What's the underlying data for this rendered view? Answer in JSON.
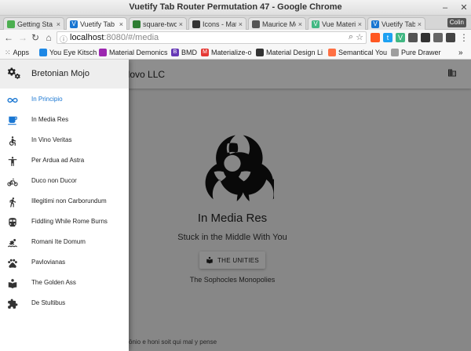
{
  "window": {
    "title": "Vuetify Tab Router Permutation 47 - Google Chrome"
  },
  "tabs": [
    {
      "label": "Getting Sta",
      "favicon_color": "#4caf50",
      "active": false
    },
    {
      "label": "Vuetify Tab",
      "favicon_color": "#1976d2",
      "active": true
    },
    {
      "label": "square-two",
      "favicon_color": "#2e7d32",
      "active": false
    },
    {
      "label": "Icons - Mat",
      "favicon_color": "#333333",
      "active": false
    },
    {
      "label": "Maurice Mo",
      "favicon_color": "#555555",
      "active": false
    },
    {
      "label": "Vue Materia",
      "favicon_color": "#42b883",
      "active": false
    },
    {
      "label": "Vuetify Tab",
      "favicon_color": "#1976d2",
      "active": false
    }
  ],
  "user_chip": "Colin",
  "address": {
    "host": "localhost",
    "path": ":8080/#/media"
  },
  "bookmarks": {
    "apps_label": "Apps",
    "items": [
      {
        "label": "You Eye Kitsch",
        "icon": "kitsch-icon",
        "color": "#1e88e5"
      },
      {
        "label": "Material Demonics",
        "icon": "material-icon",
        "color": "#9c27b0"
      },
      {
        "label": "BMD",
        "icon": "bmd-icon",
        "color": "#673ab7"
      },
      {
        "label": "Materialize-o",
        "icon": "materialize-icon",
        "color": "#e53935"
      },
      {
        "label": "Material Design Li",
        "icon": "mdl-icon",
        "color": "#333333"
      },
      {
        "label": "Semantical You",
        "icon": "semantic-icon",
        "color": "#ff7043"
      },
      {
        "label": "Pure Drawer",
        "icon": "page-icon",
        "color": "#9e9e9e"
      }
    ]
  },
  "appbar": {
    "company": "Gengenho Novo LLC",
    "company_visible": "genho Novo LLC"
  },
  "drawer": {
    "brand": "Bretonian Mojo",
    "items": [
      {
        "label": "In Principio",
        "icon": "infinity-icon",
        "active": true
      },
      {
        "label": "In Media Res",
        "icon": "coffee-icon",
        "active": false
      },
      {
        "label": "In Vino Veritas",
        "icon": "accessible-icon",
        "active": false
      },
      {
        "label": "Per Ardua ad Astra",
        "icon": "person-icon",
        "active": false
      },
      {
        "label": "Duco non Ducor",
        "icon": "bike-icon",
        "active": false
      },
      {
        "label": "Illegitimi non Carborundum",
        "icon": "walk-icon",
        "active": false
      },
      {
        "label": "Fiddling While Rome Burns",
        "icon": "train-icon",
        "active": false
      },
      {
        "label": "Romani Ite Domum",
        "icon": "pool-icon",
        "active": false
      },
      {
        "label": "Pavlovianas",
        "icon": "paw-icon",
        "active": false
      },
      {
        "label": "The Golden Ass",
        "icon": "reader-icon",
        "active": false
      },
      {
        "label": "De Stultibus",
        "icon": "puzzle-icon",
        "active": false
      }
    ]
  },
  "content": {
    "title": "In Media Res",
    "subtitle": "Stuck in the Middle With You",
    "button_label": "THE UNITIES",
    "footnote": "The Sophocles Monopolies",
    "page_footer": "ōnio e honi soit qui mal y pense"
  },
  "colors": {
    "active_nav": "#1976d2",
    "overlay": "rgba(0,0,0,0.42)"
  }
}
